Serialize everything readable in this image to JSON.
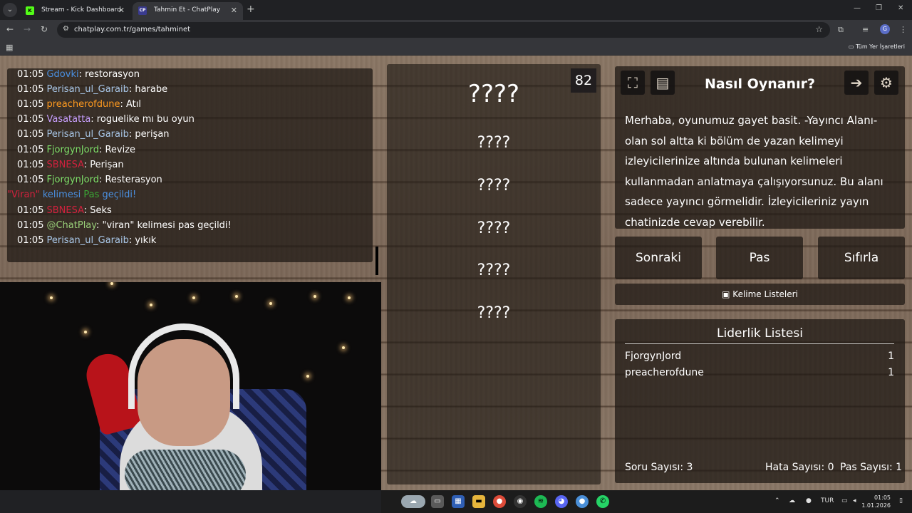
{
  "browser": {
    "tabs": [
      {
        "title": "Stream - Kick Dashboard",
        "favicon": "kick-icon"
      },
      {
        "title": "Tahmin Et - ChatPlay",
        "favicon": "chatplay-icon"
      }
    ],
    "url": "chatplay.com.tr/games/tahminet",
    "bookmarks_label": "Tüm Yer İşaretleri"
  },
  "chat": {
    "messages": [
      {
        "time": "01:05",
        "user": "Gdovki",
        "color": "#4a90e2",
        "text": ": restorasyon"
      },
      {
        "time": "01:05",
        "user": "Perisan_ul_Garaib",
        "color": "#a9c7e8",
        "text": ": harabe"
      },
      {
        "time": "01:05",
        "user": "preacherofdune",
        "color": "#ff9a1f",
        "text": ": Atıl"
      },
      {
        "time": "01:05",
        "user": "Vasatatta",
        "color": "#c9a0ff",
        "text": ": roguelike mı bu oyun"
      },
      {
        "time": "01:05",
        "user": "Perisan_ul_Garaib",
        "color": "#a9c7e8",
        "text": ": perişan"
      },
      {
        "time": "01:05",
        "user": "FjorgynJord",
        "color": "#7ee06a",
        "text": ": Revize"
      },
      {
        "time": "01:05",
        "user": "SBNESA",
        "color": "#d0213d",
        "text": ": Perişan"
      },
      {
        "time": "01:05",
        "user": "FjorgynJord",
        "color": "#7ee06a",
        "text": ": Resterasyon"
      },
      {
        "time": "01:05",
        "user": "@ChatPlay",
        "color": "#9ad17a",
        "text": ": \"viran\" kelimesi pas geçildi!"
      },
      {
        "time": "01:05",
        "user": "Perisan_ul_Garaib",
        "color": "#a9c7e8",
        "text": ": yıkık"
      }
    ],
    "system_notice": {
      "word": "\"Viran\"",
      "middle": " kelimesi ",
      "pas": "Pas",
      "end": " geçildi!",
      "colors": {
        "word": "#d0213d",
        "middle": "#4a90e2",
        "pas": "#3aa835",
        "end": "#4a90e2"
      }
    },
    "system_after_index": 7,
    "spam_user": {
      "time": "01:05",
      "user": "SBNESA",
      "color": "#d0213d",
      "text": ": Seks"
    }
  },
  "game": {
    "timer": "82",
    "main_word": "????",
    "forbidden_words": [
      "????",
      "????",
      "????",
      "????",
      "????"
    ],
    "howto": {
      "title": "Nasıl Oynanır?",
      "text": "Merhaba, oyunumuz gayet basit. -Yayıncı Alanı- olan sol altta ki bölüm de yazan kelimeyi izleyicilerinize altında bulunan kelimeleri kullanmadan anlatmaya çalışıyorsunuz. Bu alanı sadece yayıncı görmelidir. İzleyicileriniz yayın chatinizde cevap verebilir.",
      "icons": [
        "fullscreen-icon",
        "notes-icon",
        "exit-icon",
        "gear-icon"
      ]
    },
    "buttons": {
      "next": "Sonraki",
      "pass": "Pas",
      "reset": "Sıfırla"
    },
    "word_lists_label": "Kelime Listeleri",
    "leaderboard": {
      "title": "Liderlik Listesi",
      "rows": [
        {
          "name": "FjorgynJord",
          "score": "1"
        },
        {
          "name": "preacherofdune",
          "score": "1"
        }
      ]
    },
    "stats": {
      "questions": "Soru Sayısı: 3",
      "errors": "Hata Sayısı: 0",
      "passes": "Pas Sayısı: 1"
    }
  },
  "taskbar": {
    "language": "TUR",
    "time": "01:05",
    "date": "1.01.2026"
  }
}
